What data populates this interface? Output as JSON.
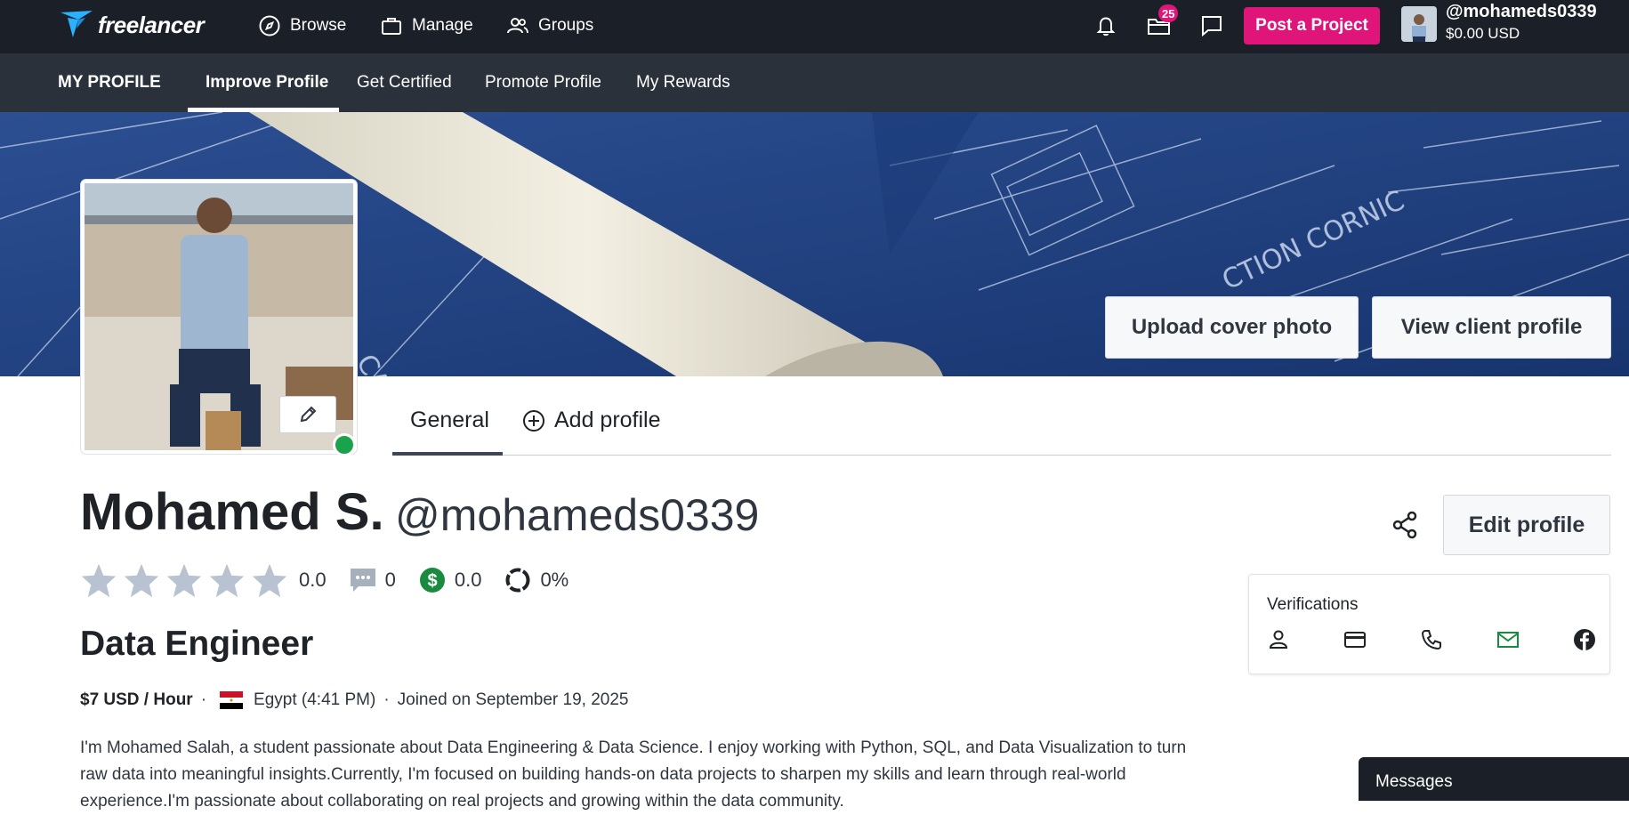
{
  "topnav": {
    "logo_text": "freelancer",
    "links": [
      {
        "label": "Browse",
        "icon": "compass-icon"
      },
      {
        "label": "Manage",
        "icon": "briefcase-icon"
      },
      {
        "label": "Groups",
        "icon": "users-icon"
      }
    ],
    "notification_badge": "25",
    "post_project_label": "Post a Project",
    "username": "@mohameds0339",
    "balance": "$0.00 USD"
  },
  "subnav": {
    "section_label": "MY PROFILE",
    "items": [
      "Improve Profile",
      "Get Certified",
      "Promote Profile",
      "My Rewards"
    ],
    "active_index": 0
  },
  "cover": {
    "upload_label": "Upload cover photo",
    "view_client_label": "View client profile"
  },
  "tabs": [
    {
      "label": "General",
      "active": true
    },
    {
      "label": "Add profile",
      "active": false
    }
  ],
  "profile": {
    "name": "Mohamed S.",
    "handle": "@mohameds0339",
    "rating": "0.0",
    "reviews": "0",
    "earnings_score": "0.0",
    "completion": "0%",
    "title": "Data Engineer",
    "rate": "$7 USD / Hour",
    "location": "Egypt (4:41 PM)",
    "joined": "Joined on September 19, 2025",
    "bio": "I'm Mohamed Salah, a student passionate about Data Engineering & Data Science. I enjoy working with Python, SQL, and Data Visualization to turn raw data into meaningful insights.Currently, I'm focused on building hands-on data projects to sharpen my skills and learn through real-world experience.I'm passionate about collaborating on real projects and growing within the data community."
  },
  "actions": {
    "edit_profile_label": "Edit profile"
  },
  "verifications": {
    "title": "Verifications",
    "items": [
      "identity",
      "payment",
      "phone",
      "email",
      "facebook"
    ],
    "verified_color": "#1a8a3f"
  },
  "messages": {
    "label": "Messages"
  },
  "colors": {
    "brand_pink": "#e0157a",
    "nav_bg": "#1b1f27",
    "subnav_bg": "#2b313b",
    "online": "#1aa34a"
  }
}
